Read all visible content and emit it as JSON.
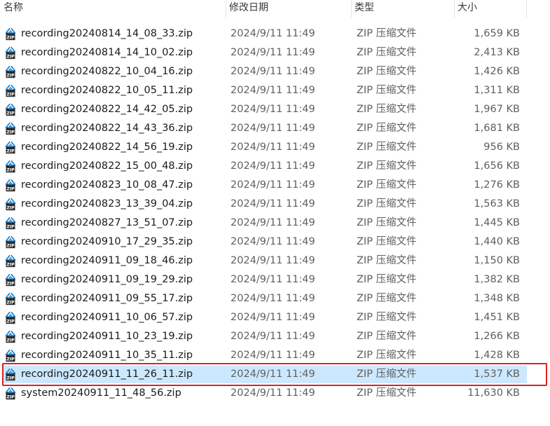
{
  "columns": {
    "name": "名称",
    "date": "修改日期",
    "type": "类型",
    "size": "大小"
  },
  "selected_index": 18,
  "highlight_color": "#e02020",
  "selection_color": "#cce8ff",
  "file_icon": "zip-archive-icon",
  "files": [
    {
      "name": "recording20240814_14_08_33.zip",
      "date": "2024/9/11 11:49",
      "type": "ZIP 压缩文件",
      "size": "1,659 KB"
    },
    {
      "name": "recording20240814_14_10_02.zip",
      "date": "2024/9/11 11:49",
      "type": "ZIP 压缩文件",
      "size": "2,413 KB"
    },
    {
      "name": "recording20240822_10_04_16.zip",
      "date": "2024/9/11 11:49",
      "type": "ZIP 压缩文件",
      "size": "1,426 KB"
    },
    {
      "name": "recording20240822_10_05_11.zip",
      "date": "2024/9/11 11:49",
      "type": "ZIP 压缩文件",
      "size": "1,311 KB"
    },
    {
      "name": "recording20240822_14_42_05.zip",
      "date": "2024/9/11 11:49",
      "type": "ZIP 压缩文件",
      "size": "1,967 KB"
    },
    {
      "name": "recording20240822_14_43_36.zip",
      "date": "2024/9/11 11:49",
      "type": "ZIP 压缩文件",
      "size": "1,681 KB"
    },
    {
      "name": "recording20240822_14_56_19.zip",
      "date": "2024/9/11 11:49",
      "type": "ZIP 压缩文件",
      "size": "956 KB"
    },
    {
      "name": "recording20240822_15_00_48.zip",
      "date": "2024/9/11 11:49",
      "type": "ZIP 压缩文件",
      "size": "1,656 KB"
    },
    {
      "name": "recording20240823_10_08_47.zip",
      "date": "2024/9/11 11:49",
      "type": "ZIP 压缩文件",
      "size": "1,276 KB"
    },
    {
      "name": "recording20240823_13_39_04.zip",
      "date": "2024/9/11 11:49",
      "type": "ZIP 压缩文件",
      "size": "1,563 KB"
    },
    {
      "name": "recording20240827_13_51_07.zip",
      "date": "2024/9/11 11:49",
      "type": "ZIP 压缩文件",
      "size": "1,445 KB"
    },
    {
      "name": "recording20240910_17_29_35.zip",
      "date": "2024/9/11 11:49",
      "type": "ZIP 压缩文件",
      "size": "1,440 KB"
    },
    {
      "name": "recording20240911_09_18_46.zip",
      "date": "2024/9/11 11:49",
      "type": "ZIP 压缩文件",
      "size": "1,150 KB"
    },
    {
      "name": "recording20240911_09_19_29.zip",
      "date": "2024/9/11 11:49",
      "type": "ZIP 压缩文件",
      "size": "1,382 KB"
    },
    {
      "name": "recording20240911_09_55_17.zip",
      "date": "2024/9/11 11:49",
      "type": "ZIP 压缩文件",
      "size": "1,348 KB"
    },
    {
      "name": "recording20240911_10_06_57.zip",
      "date": "2024/9/11 11:49",
      "type": "ZIP 压缩文件",
      "size": "1,451 KB"
    },
    {
      "name": "recording20240911_10_23_19.zip",
      "date": "2024/9/11 11:49",
      "type": "ZIP 压缩文件",
      "size": "1,266 KB"
    },
    {
      "name": "recording20240911_10_35_11.zip",
      "date": "2024/9/11 11:49",
      "type": "ZIP 压缩文件",
      "size": "1,428 KB"
    },
    {
      "name": "recording20240911_11_26_11.zip",
      "date": "2024/9/11 11:49",
      "type": "ZIP 压缩文件",
      "size": "1,537 KB"
    },
    {
      "name": "system20240911_11_48_56.zip",
      "date": "2024/9/11 11:49",
      "type": "ZIP 压缩文件",
      "size": "11,630 KB"
    }
  ]
}
